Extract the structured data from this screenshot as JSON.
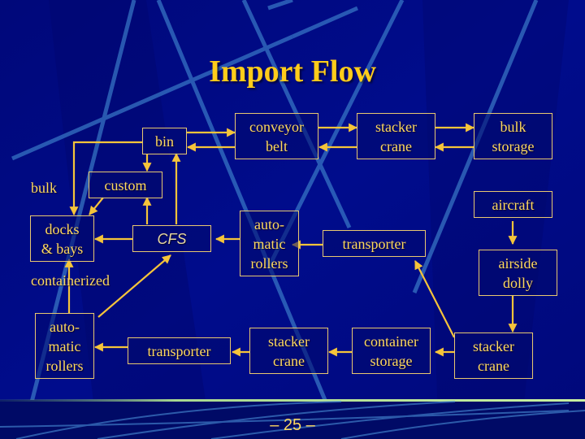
{
  "slide": {
    "title": "Import Flow",
    "page_number": "–  25  –"
  },
  "colors": {
    "background": "#000a80",
    "accent_text": "#ffcc1a",
    "box_border": "#e8c870",
    "arrow": "#f5c43a",
    "divider": "#b8e890"
  },
  "nodes": {
    "bin": "bin",
    "conveyor_belt": "conveyor\nbelt",
    "stacker_crane_top": "stacker\ncrane",
    "bulk_storage": "bulk\nstorage",
    "custom": "custom",
    "aircraft": "aircraft",
    "docks_bays": "docks\n& bays",
    "cfs": "CFS",
    "auto_rollers_mid": "auto-\nmatic\nrollers",
    "transporter_mid": "transporter",
    "airside_dolly": "airside\ndolly",
    "auto_rollers_bottom": "auto-\nmatic\nrollers",
    "transporter_bottom": "transporter",
    "stacker_crane_mid": "stacker\ncrane",
    "container_storage": "container\nstorage",
    "stacker_crane_right": "stacker\ncrane"
  },
  "labels": {
    "bulk": "bulk",
    "containerized": "containerized"
  },
  "edges": [
    {
      "from": "bin",
      "to": "conveyor_belt"
    },
    {
      "from": "conveyor_belt",
      "to": "bin"
    },
    {
      "from": "conveyor_belt",
      "to": "stacker_crane_top"
    },
    {
      "from": "stacker_crane_top",
      "to": "conveyor_belt"
    },
    {
      "from": "stacker_crane_top",
      "to": "bulk_storage"
    },
    {
      "from": "bulk_storage",
      "to": "stacker_crane_top"
    },
    {
      "from": "bin",
      "to": "custom"
    },
    {
      "from": "bin",
      "to": "docks_bays"
    },
    {
      "from": "custom",
      "to": "docks_bays"
    },
    {
      "from": "cfs",
      "to": "custom"
    },
    {
      "from": "cfs",
      "to": "bin"
    },
    {
      "from": "cfs",
      "to": "docks_bays"
    },
    {
      "from": "auto_rollers_mid",
      "to": "cfs"
    },
    {
      "from": "transporter_mid",
      "to": "auto_rollers_mid"
    },
    {
      "from": "aircraft",
      "to": "airside_dolly"
    },
    {
      "from": "airside_dolly",
      "to": "stacker_crane_right"
    },
    {
      "from": "stacker_crane_right",
      "to": "transporter_mid"
    },
    {
      "from": "stacker_crane_right",
      "to": "container_storage"
    },
    {
      "from": "container_storage",
      "to": "stacker_crane_mid"
    },
    {
      "from": "stacker_crane_mid",
      "to": "transporter_bottom"
    },
    {
      "from": "transporter_bottom",
      "to": "auto_rollers_bottom"
    },
    {
      "from": "auto_rollers_bottom",
      "to": "docks_bays"
    },
    {
      "from": "auto_rollers_bottom",
      "to": "cfs"
    }
  ]
}
